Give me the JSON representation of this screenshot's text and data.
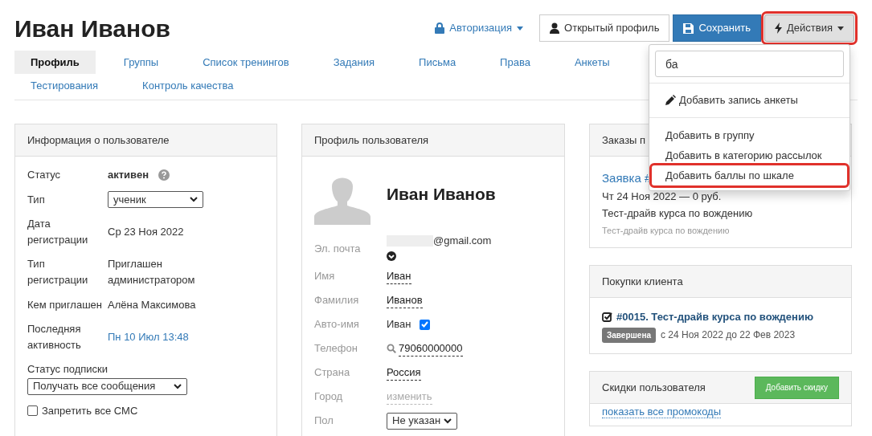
{
  "page_title": "Иван Иванов",
  "header_actions": {
    "auth_link": "Авторизация",
    "open_profile_button": "Открытый профиль",
    "save_button": "Сохранить",
    "actions_button": {
      "label": "Действия",
      "highlighted": true
    }
  },
  "tabs": [
    {
      "label": "Профиль",
      "selected": true
    },
    {
      "label": "Группы",
      "selected": false
    },
    {
      "label": "Список тренингов",
      "selected": false
    },
    {
      "label": "Задания",
      "selected": false
    },
    {
      "label": "Письма",
      "selected": false
    },
    {
      "label": "Права",
      "selected": false
    },
    {
      "label": "Анкеты",
      "selected": false
    },
    {
      "label": "Тестирования",
      "selected": false
    },
    {
      "label": "Контроль качества",
      "selected": false
    }
  ],
  "user_info": {
    "title": "Информация о пользователе",
    "rows": [
      {
        "kind": "status",
        "label": "Статус",
        "value": "активен"
      },
      {
        "kind": "select",
        "label": "Тип",
        "value": "ученик"
      },
      {
        "kind": "text",
        "label": "Дата регистрации",
        "value": "Ср 23 Ноя 2022"
      },
      {
        "kind": "text",
        "label": "Тип регистрации",
        "value": "Приглашен администратором"
      },
      {
        "kind": "text",
        "label": "Кем приглашен",
        "value": "Алёна Максимова"
      },
      {
        "kind": "link",
        "label": "Последняя активность",
        "value": "Пн 10 Июл 13:48"
      }
    ],
    "subscription": {
      "label": "Статус подписки",
      "value": "Получать все сообщения"
    },
    "sms_block": {
      "label": "Запретить все СМС",
      "checked": false
    }
  },
  "user_profile": {
    "title": "Профиль пользователя",
    "name": "Иван Иванов",
    "email": {
      "label": "Эл. почта",
      "value": "@gmail.com"
    },
    "fields": [
      {
        "kind": "editable",
        "label": "Имя",
        "value": "Иван"
      },
      {
        "kind": "editable",
        "label": "Фамилия",
        "value": "Иванов"
      },
      {
        "kind": "auto",
        "label": "Авто-имя",
        "value": "Иван",
        "checked": true
      },
      {
        "kind": "phone",
        "label": "Телефон",
        "value": "79060000000"
      },
      {
        "kind": "editable",
        "label": "Страна",
        "value": "Россия"
      },
      {
        "kind": "muted",
        "label": "Город",
        "value": "изменить"
      },
      {
        "kind": "select",
        "label": "Пол",
        "value": "Не указан"
      }
    ]
  },
  "orders": {
    "title": "Заказы п",
    "link": "Заявка #",
    "date": "Чт 24 Ноя 2022 — 0 руб.",
    "product": "Тест-драйв курса по вождению",
    "note": "Тест-драйв курса по вождению"
  },
  "purchases": {
    "title": "Покупки клиента",
    "item": "#0015. Тест-драйв курса по вождению",
    "badge": "Завершена",
    "period": "с 24 Ноя 2022 до 22 Фев 2023"
  },
  "discounts": {
    "title": "Скидки пользователя",
    "add_button": "Добавить скидку",
    "promo_link": "показать все промокоды"
  },
  "actions_menu": {
    "search_value": "ба",
    "groups": [
      [
        {
          "kind": "edit",
          "label": "Добавить запись анкеты",
          "highlighted": false
        }
      ],
      [
        {
          "kind": "plain",
          "label": "Добавить в группу",
          "highlighted": false
        },
        {
          "kind": "plain",
          "label": "Добавить в категорию рассылок",
          "highlighted": false
        },
        {
          "kind": "plain",
          "label": "Добавить баллы по шкале",
          "highlighted": true
        }
      ]
    ]
  }
}
